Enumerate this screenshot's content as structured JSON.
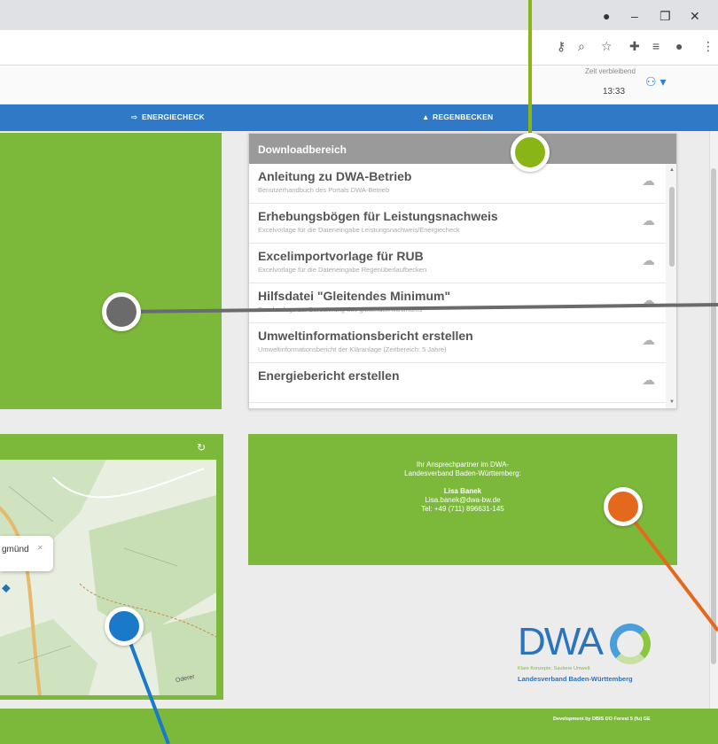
{
  "window": {
    "minimize": "–",
    "maximize": "❐",
    "close": "✕"
  },
  "toolbar": {
    "key_icon": "key-icon",
    "zoom_icon": "zoom-icon",
    "star_icon": "star-icon",
    "ext_icon": "puzzle-icon",
    "queue_icon": "queue-icon",
    "profile_icon": "profile-icon",
    "menu_icon": "menu-icon"
  },
  "header": {
    "time_label": "Zeit verbleibend",
    "time_value": "13:33"
  },
  "nav": {
    "energiecheck": "ENERGIECHECK",
    "regenbecken": "REGENBECKEN"
  },
  "downloads": {
    "heading": "Downloadbereich",
    "items": [
      {
        "title": "Anleitung zu DWA-Betrieb",
        "subtitle": "Benutzerhandbuch des Portals DWA-Betrieb"
      },
      {
        "title": "Erhebungsbögen für Leistungsnachweis",
        "subtitle": "Excelvorlage für die Dateneingabe Leistungsnachweis/Energiecheck"
      },
      {
        "title": "Excelimportvorlage für RUB",
        "subtitle": "Excelvorlage für die Dateneingabe Regenüberlaufbecken"
      },
      {
        "title": "Hilfsdatei \"Gleitendes Minimum\"",
        "subtitle": "Excelvorlage zur Berechnung des gleitenden Minimums"
      },
      {
        "title": "Umweltinformationsbericht erstellen",
        "subtitle": "Umweltinformationsbericht der Kläranlage (Zeitbereich: 5 Jahre)"
      },
      {
        "title": "Energiebericht erstellen",
        "subtitle": ""
      }
    ]
  },
  "map": {
    "popup_label": "gmünd",
    "place_label": "Oderer"
  },
  "contact": {
    "line1": "Ihr Ansprechpartner im DWA-",
    "line2": "Landesverband Baden-Württemberg:",
    "name": "Lisa Banek",
    "email": "Lisa.banek@dwa-bw.de",
    "phone": "Tel: +49 (711) 896631-145"
  },
  "logo": {
    "text": "DWA",
    "tagline": "Klare Konzepte. Saubere Umwelt.",
    "sub": "Landesverband Baden-Württemberg"
  },
  "footer": {
    "text": "Development by DBIS DO Forest 5 (fu) GE"
  },
  "colors": {
    "green": "#7cb93a",
    "blue": "#2f79c6",
    "callout_green": "#8ab516",
    "callout_gray": "#6b6b6b",
    "callout_orange": "#e5691d",
    "callout_blue": "#1a7ac9"
  }
}
